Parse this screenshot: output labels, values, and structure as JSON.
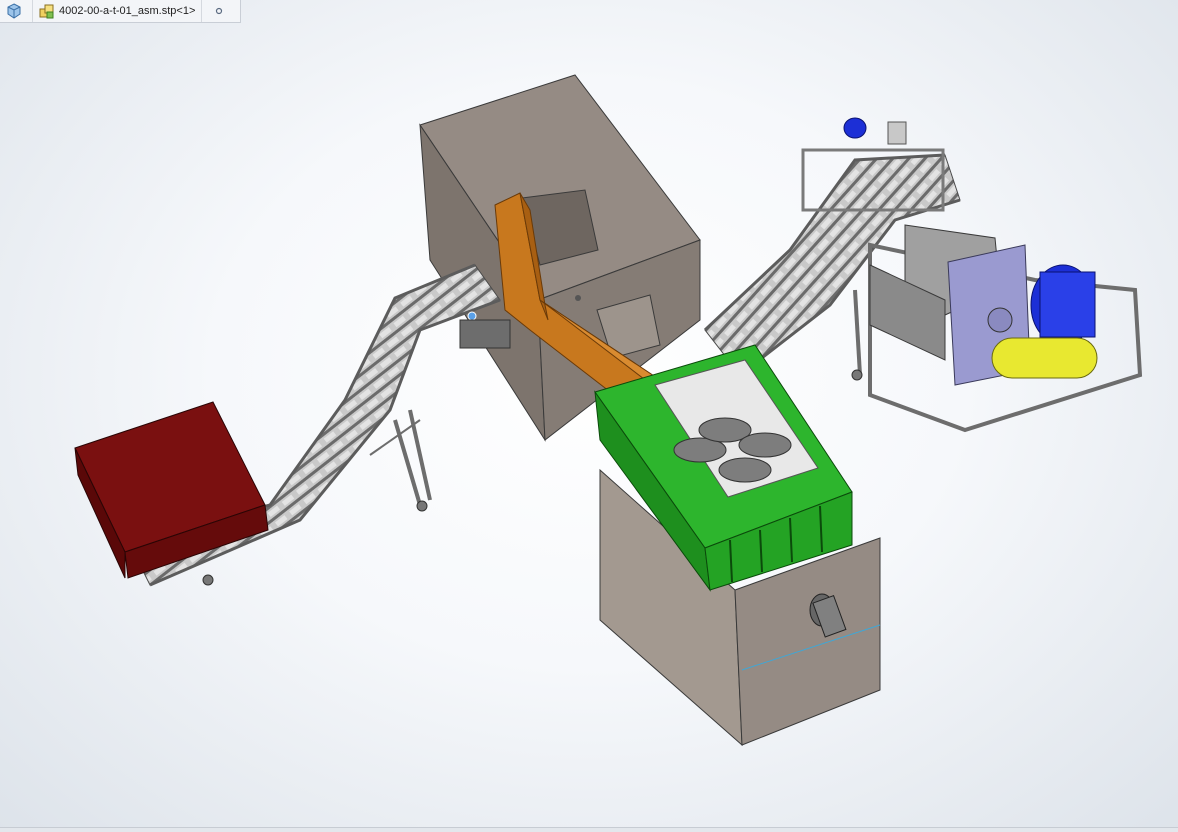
{
  "window": {
    "title": "4002-00-a-t-01_asm.stp<1>"
  },
  "breadcrumb": {
    "root_icon": "part-cube-icon",
    "assembly_icon": "assembly-icon",
    "assembly_label": "4002-00-a-t-01_asm.stp<1>",
    "end_icon": "dot-icon"
  },
  "model": {
    "colors": {
      "frame": "#8f8f8f",
      "cabinet": "#8a8078",
      "chute": "#c8781e",
      "shredder_box": "#1f9d1f",
      "hood": "#7a1010",
      "motor": "#1c2fd6",
      "gearbox": "#9a9ad0",
      "belt_guard": "#e8e830"
    }
  }
}
